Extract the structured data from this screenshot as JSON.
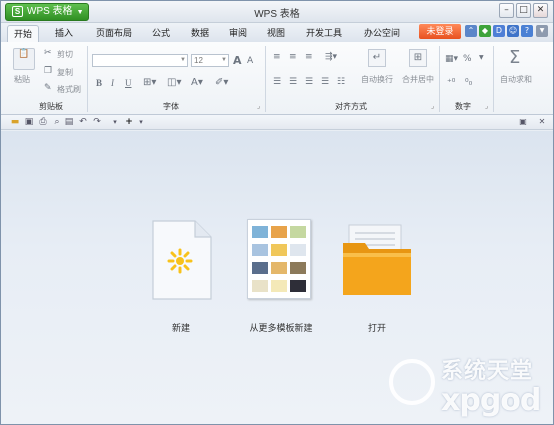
{
  "window": {
    "app_button": "WPS 表格",
    "app_logo": "S",
    "title": "WPS 表格",
    "login_label": "未登录"
  },
  "tabs": [
    {
      "label": "开始"
    },
    {
      "label": "插入"
    },
    {
      "label": "页面布局"
    },
    {
      "label": "公式"
    },
    {
      "label": "数据"
    },
    {
      "label": "审阅"
    },
    {
      "label": "视图"
    },
    {
      "label": "开发工具"
    },
    {
      "label": "办公空间"
    }
  ],
  "ribbon": {
    "clipboard": {
      "paste": "粘贴",
      "cut": "剪切",
      "copy": "复制",
      "format_painter": "格式刷",
      "group": "剪贴板"
    },
    "font": {
      "font_name": "",
      "font_size": "12",
      "bold": "B",
      "italic": "I",
      "underline": "U",
      "grow": "A",
      "shrink": "A",
      "group": "字体"
    },
    "alignment": {
      "wrap": "自动换行",
      "merge": "合并居中",
      "group": "对齐方式"
    },
    "number": {
      "percent": "%",
      "group": "数字"
    },
    "autosum": "自动求和"
  },
  "start_page": {
    "new_label": "新建",
    "template_label": "从更多模板新建",
    "open_label": "打开"
  },
  "watermark": {
    "line1": "系统天堂",
    "line2": "xpgod"
  },
  "colors": {
    "app_green": "#2f8f23",
    "login_orange": "#e8511f",
    "folder_orange": "#f4a51c",
    "doc_yellow": "#f8c21a"
  }
}
